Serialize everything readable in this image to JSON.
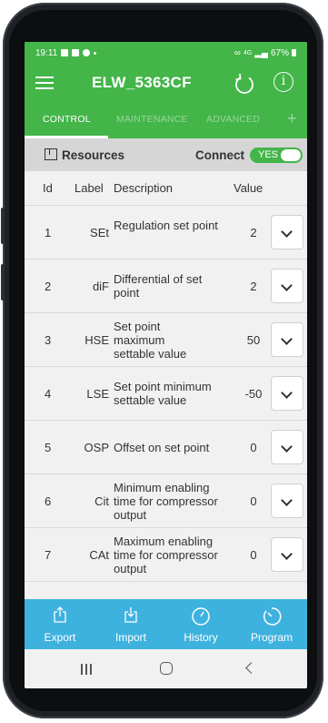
{
  "status_bar": {
    "time": "19:11",
    "battery": "67%",
    "network": "4G"
  },
  "app_bar": {
    "title": "ELW_5363CF"
  },
  "tabs": [
    {
      "label": "CONTROL",
      "active": true
    },
    {
      "label": "MAINTENANCE",
      "active": false
    },
    {
      "label": "ADVANCED",
      "active": false
    },
    {
      "label": "+",
      "active": false
    }
  ],
  "resources": {
    "label": "Resources",
    "connect_label": "Connect",
    "toggle_label": "YES",
    "toggle_on": true
  },
  "table": {
    "headers": {
      "id": "Id",
      "label": "Label",
      "description": "Description",
      "value": "Value"
    },
    "rows": [
      {
        "id": "1",
        "label": "SEt",
        "description": "Regulation set point",
        "value": "2"
      },
      {
        "id": "2",
        "label": "diF",
        "description": "Differential of set point",
        "value": "2"
      },
      {
        "id": "3",
        "label": "HSE",
        "description": "Set point maximum settable value",
        "value": "50"
      },
      {
        "id": "4",
        "label": "LSE",
        "description": "Set point minimum settable value",
        "value": "-50"
      },
      {
        "id": "5",
        "label": "OSP",
        "description": "Offset on set point",
        "value": "0"
      },
      {
        "id": "6",
        "label": "Cit",
        "description": "Minimum enabling time for compressor output",
        "value": "0"
      },
      {
        "id": "7",
        "label": "CAt",
        "description": "Maximum enabling time for compressor output",
        "value": "0"
      }
    ]
  },
  "bottom_nav": [
    {
      "label": "Export",
      "icon": "export-icon"
    },
    {
      "label": "Import",
      "icon": "import-icon"
    },
    {
      "label": "History",
      "icon": "history-icon"
    },
    {
      "label": "Program",
      "icon": "program-icon"
    }
  ],
  "colors": {
    "accent_green": "#43b549",
    "bottom_bar_blue": "#3eb2de"
  }
}
